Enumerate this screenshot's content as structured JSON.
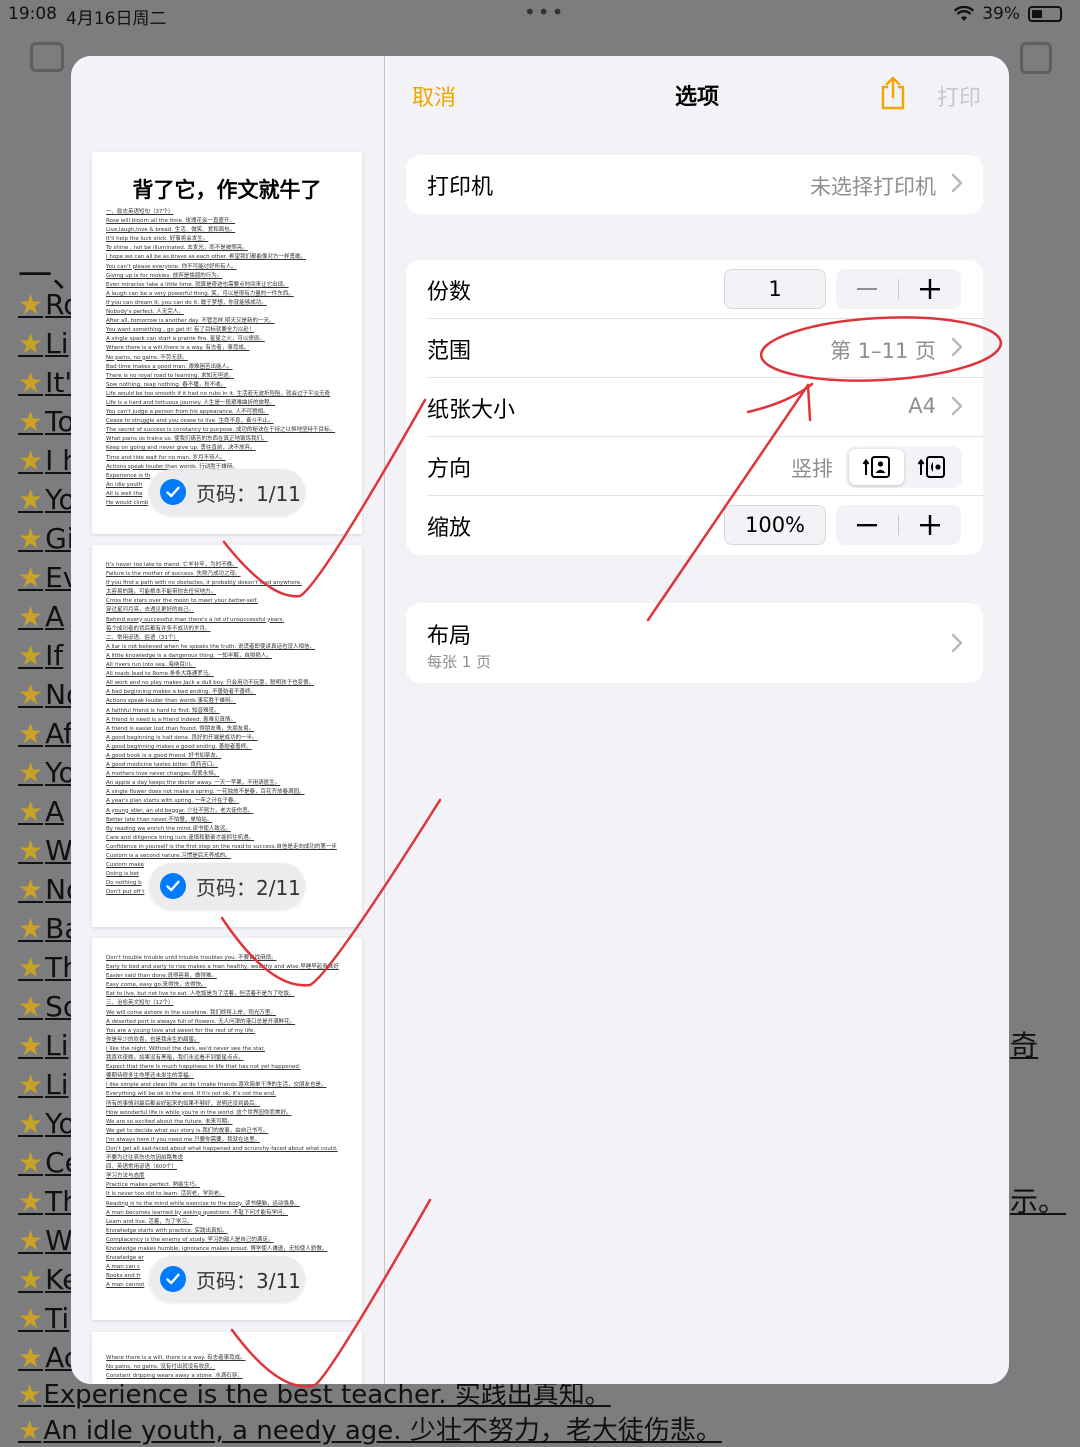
{
  "status_bar": {
    "time": "19:08",
    "date": "4月16日周二",
    "battery_percent": "39%",
    "battery_level": 0.39
  },
  "background_document": {
    "heading": "一、",
    "lines": [
      "Ro",
      "Li",
      "It'",
      "To",
      "I h",
      "Yo",
      "Gi",
      "Ev",
      "A",
      "If",
      "No",
      "Af",
      "Yo",
      "A",
      "W",
      "No",
      "Ba",
      "Th",
      "So",
      "Li",
      "Li",
      "Yo",
      "Ce",
      "Th",
      "W",
      "Ke",
      "Ti",
      "Ac"
    ],
    "bottom_lines": [
      "Experience is the best teacher. 实践出真知。",
      "An idle youth, a needy age. 少壮不努力，老大徒伤悲。"
    ],
    "right_fragments": [
      "奇",
      "示。"
    ]
  },
  "modal": {
    "cancel_label": "取消",
    "title": "选项",
    "print_label": "打印",
    "printer": {
      "label": "打印机",
      "value": "未选择打印机"
    },
    "copies": {
      "label": "份数",
      "value": "1"
    },
    "range": {
      "label": "范围",
      "value": "第 1–11 页"
    },
    "paper": {
      "label": "纸张大小",
      "value": "A4"
    },
    "orientation": {
      "label": "方向",
      "value": "竖排"
    },
    "scale": {
      "label": "缩放",
      "value": "100%"
    },
    "layout": {
      "label": "布局",
      "subtitle": "每张 1 页"
    }
  },
  "previews": [
    {
      "badge": "页码：1/11",
      "title": "背了它，作文就牛了",
      "lines": [
        "一、励志英语短句（37个）",
        "Rose will bloom all the time. 玫瑰花会一直盛开。",
        "Live,laugh,love & bread. 生活、微笑、爱和面包。",
        "It'll help the luck stick. 好事将会发生。",
        "To shine , not be illuminated. 去发光，而不是被照亮。",
        "I hope we can all be as brave as each other. 希望我们都能像对方一样勇敢。",
        "You can't please everyone. 你不可能讨好所有人。",
        "Giving up is for rookies. 放弃是懦弱的行为。",
        "Even miracles take a little time. 就算是奇迹也需要点时间来让它出现。",
        "A laugh can be a very powerful thing. 笑，可以是很有力量的一件东西。",
        "If you can dream it, you can do it. 敢于梦想，你就能够成功。",
        "Nobody's perfect. 人无完人。",
        "After all, tomorrow is another day. 不管怎样,明天又是新的一天。",
        "You want something , go get it! 有了目标就要全力以赴！",
        "A single spark can start a prairie fire. 星星之火，可以燎原。",
        "Where there is a will,there is a way. 有志者，事竟成。",
        "No pains, no gains. 不劳无获。",
        "Bad time makes a good man. 艰难困苦出能人。",
        "There is no royal road to learning. 求知无坦途。",
        "Sow nothing, reap nothing. 春不播，秋不收。",
        "Life would be too smooth if it had no rubs in it. 生活若无波折险阻，就会过于平淡无奇",
        "Life is a hard and tortuous journey. 人生是一段艰难曲折的旅程。",
        "You can't judge a person from his appearance. 人不可貌相。",
        "Cease to struggle and you cease to live. 生命不息，奋斗不止。",
        "The secret of success is constancy to purpose. 成功的秘诀在于持之以恒地坚持于目标。",
        "What pains us trains us. 使我们痛苦的东西在真正地锻炼我们。",
        "Keep on going and never give up. 勇往直前，决不放弃。",
        "Time and tide wait for no man. 岁月不待人。",
        "Actions speak louder than words. 行动胜于雄辩。",
        "Experience is th",
        "An idle youth",
        "All is well tha",
        "He would climb"
      ]
    },
    {
      "badge": "页码：2/11",
      "lines": [
        "It's never too late to mend. 亡羊补牢，为时不晚。",
        "Failure is the mother of success. 失败乃成功之母。",
        "If you find a path with no obstacles, it probably doesn't lead anywhere.",
        "太容易的路，可能根本不能带你去任何地方。",
        "Cross the stars over the moon to meet your better-self.",
        "穿过星河月亮，去遇见更好的自己。",
        "Behind every successful man there's a lot of unsuccessful years.",
        "每个成功者的背后都有许多不成功的岁月。",
        "二、常用谚语、俗语（31个）",
        "A liar is not believed when he speaks the truth. 说谎者即使讲真话也没人相信。",
        "A little knowledge is a dangerous thing. 一知半解，自损损人。",
        "All rivers run into sea. 海纳百川。",
        "All roads lead to Rome.条条大路通罗马。",
        "All work and no play makes Jack a dull boy. 只会用功不玩耍，聪明孩子也变傻。",
        "A bad beginning makes a bad ending. 不善始者不善终。",
        "Actions speak louder than words.事实胜于雄辩。",
        "A faithful friend is hard to find. 知音难觅。",
        "A friend in need is a friend indeed. 患难见真情。",
        "A friend is easier lost than found. 得朋友难，失朋友易。",
        "A good beginning is half done. 良好的开端是成功的一半。",
        "A good beginning makes a good ending. 善始者善终。",
        "A good book is a good friend. 好书如挚友。",
        "A good medicine tastes bitter. 良药苦口。",
        "A mothers love never changes.母爱永恒。",
        "An apple a day keeps the doctor away. 一天一苹果，不用请医生。",
        "A single flower does not make a spring. 一花独放不是春，百花齐放春满园。",
        "A year's plan starts with spring. 一年之计在于春。",
        "A young idler, an old beggar. 少壮不努力，老大徒伤悲。",
        "Better late than never.不怕慢，单怕站。",
        "By reading we enrich the mind.读书使人致远。",
        "Care and diligence bring luck.谨慎和勤奋才能抓住机遇。",
        "Confidence in yourself is the first step on the road to success.自信是走向成功的第一步",
        "Custom is a second nature.习惯是后天养成的。",
        "Custom make",
        "Doing is bet",
        "Do nothing b",
        "Don't put off t"
      ]
    },
    {
      "badge": "页码：3/11",
      "lines": [
        "Don't trouble trouble until trouble troubles you. 不要自找麻烦。",
        "Early to bed and early to rise makes a man healthy, wealthy and wise.早睡早起身体好",
        "Easier said than done.说得容易，做得难。",
        "Easy come, easy go.来得快，去得快。",
        "Eat to live, but not live to eat. 人吃饭是为了活着，但活着不是为了吃饭。",
        "三、治愈英文短句（12个）",
        "We will come ashore in the sunshine. 我们终将上岸，阳光万里。",
        "A deserted port is always full of flowers. 无人问津的港口总是开满鲜花。",
        "You are a young love and sweet for the rest of my life.",
        "你是年少的欢喜，也是我余生的甜蜜。",
        "I like the night. Without the dark, we'd never see the star.",
        "我喜欢夜晚，如果没有黑暗，我们永远看不到繁星点点。",
        "Expect that there is much happiness in life that has not yet happened.",
        "要期待很多生命里还未发生的幸福。",
        "I like simple and clean life ,so do I make friends.喜欢简单干净的生活，交朋友也是。",
        "Everything will be ok in the end, if it's not ok, it's not the end.",
        "所有的事情到最后都会好起来的如果不够好，说明还没到最后。",
        "How wonderful life is while you're in the world. 这个世界因你而美好。",
        "We are so excited about the future. 未来可期。",
        "We get to decide what our story is.我们的故事，由自己书写。",
        "I'm always here if you need me.只要你需要，我就在这里。",
        "Don't get all sad-faced about what happened and scrunchy-faced about what could.",
        "不要为过往哀伤也勿因前路焦虑",
        "四、英语常用谚语（600个）",
        "学习方法与态度",
        "Practice makes perfect. 熟能生巧。",
        "It is never too old to learn. 活到老，学到老。",
        "Reading is to the mind while exercise to the body. 读书健脑，运动强身。",
        "A man becomes learned by asking questions. 不耻下问才能有学问。",
        "Learn and live. 活着，为了学习。",
        "Knowledge starts with practice. 实践出真知。",
        "Complacency is the enemy of study. 学习的敌人是自己的满足。",
        "Knowledge makes humble, ignorance makes proud. 博学使人谦逊，无知使人骄傲。",
        "Knowledge ar",
        "A man can c",
        "Books and fr",
        "A man cannot"
      ]
    },
    {
      "badge": "",
      "lines": [
        "Where there is a will, there is a way. 有志者事竟成。",
        "No pains, no gains. 没有付出就没有收获。",
        "Constant dripping wears away a stone. 水滴石穿。"
      ]
    }
  ]
}
